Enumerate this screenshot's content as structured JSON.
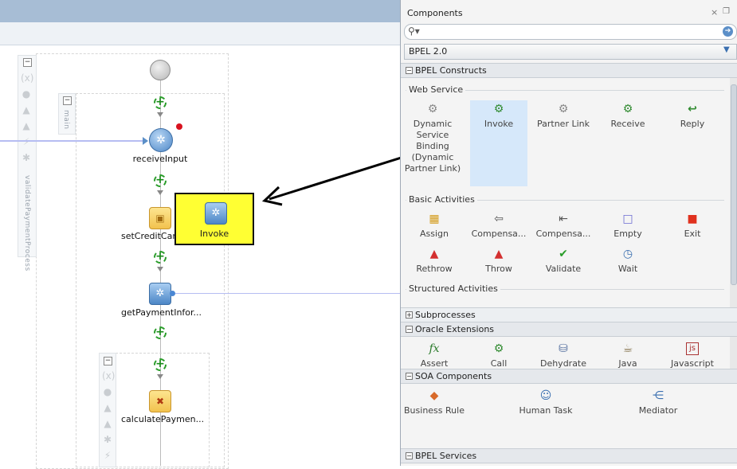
{
  "panel": {
    "title": "Components",
    "search_placeholder": "",
    "palette_select": "BPEL 2.0",
    "sections": {
      "bpel_constructs": "BPEL Constructs",
      "subprocesses": "Subprocesses",
      "oracle_extensions": "Oracle Extensions",
      "soa_components": "SOA Components",
      "bpel_services": "BPEL Services"
    },
    "subsections": {
      "web_service": "Web Service",
      "basic_activities": "Basic Activities",
      "structured_activities": "Structured Activities"
    },
    "web_service_items": [
      "Dynamic Service Binding (Dynamic Partner Link)",
      "Invoke",
      "Partner Link",
      "Receive",
      "Reply"
    ],
    "basic_items_row1": [
      "Assign",
      "Compensa...",
      "Compensa...",
      "Empty",
      "Exit"
    ],
    "basic_items_row2": [
      "Rethrow",
      "Throw",
      "Validate",
      "Wait"
    ],
    "oracle_items": [
      "Assert",
      "Call",
      "Dehydrate",
      "Java",
      "Javascript"
    ],
    "soa_items": [
      "Business Rule",
      "Human Task",
      "Mediator"
    ]
  },
  "canvas": {
    "outer_scope_label": "validatePaymentProcess",
    "main_scope_label": "main",
    "nodes": {
      "receive": "receiveInput",
      "set_credit": "setCreditCardNu...",
      "get_payment": "getPaymentInfor...",
      "calc_payment": "calculatePaymen..."
    },
    "dragged_item": "Invoke"
  },
  "colors": {
    "drag_highlight": "#ffff33",
    "selected_tile": "#d6e8fa",
    "accent": "#5b8fc8"
  }
}
